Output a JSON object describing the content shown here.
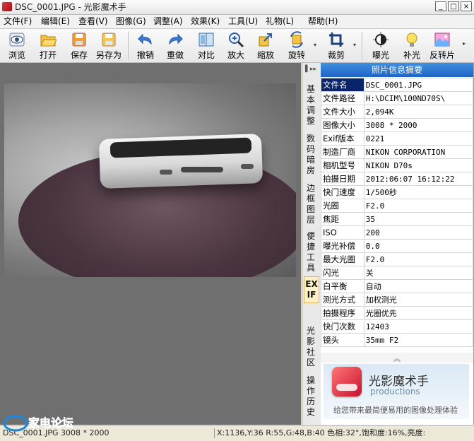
{
  "window": {
    "title": "DSC_0001.JPG - 光影魔术手",
    "min": "_",
    "max": "□",
    "close": "×"
  },
  "menu": [
    "文件(F)",
    "编辑(E)",
    "查看(V)",
    "图像(G)",
    "调整(A)",
    "效果(K)",
    "工具(U)",
    "礼物(L)",
    "帮助(H)"
  ],
  "toolbar": [
    {
      "label": "浏览",
      "icon": "eye-icon"
    },
    {
      "label": "打开",
      "icon": "folder-open-icon"
    },
    {
      "label": "保存",
      "icon": "save-icon"
    },
    {
      "label": "另存为",
      "icon": "save-as-icon"
    },
    {
      "label": "撤销",
      "icon": "undo-icon"
    },
    {
      "label": "重做",
      "icon": "redo-icon"
    },
    {
      "label": "对比",
      "icon": "compare-icon"
    },
    {
      "label": "放大",
      "icon": "zoom-in-icon"
    },
    {
      "label": "缩放",
      "icon": "resize-icon"
    },
    {
      "label": "旋转",
      "icon": "rotate-icon"
    },
    {
      "label": "裁剪",
      "icon": "crop-icon"
    },
    {
      "label": "曝光",
      "icon": "exposure-icon"
    },
    {
      "label": "补光",
      "icon": "fill-light-icon"
    },
    {
      "label": "反转片",
      "icon": "reversal-film-icon"
    }
  ],
  "side_tabs": [
    "基本调整",
    "数码暗房",
    "边框图层",
    "便捷工具",
    "EXIF",
    "光影社区",
    "操作历史"
  ],
  "active_tab": "EXIF",
  "panel": {
    "title": "照片信息摘要",
    "rows": [
      {
        "key": "文件名",
        "value": "DSC_0001.JPG"
      },
      {
        "key": "文件路径",
        "value": "H:\\DCIM\\100ND70S\\"
      },
      {
        "key": "文件大小",
        "value": "2,094K"
      },
      {
        "key": "图像大小",
        "value": "3008 * 2000"
      },
      {
        "key": "Exif版本",
        "value": "0221"
      },
      {
        "key": "制造厂商",
        "value": "NIKON CORPORATION"
      },
      {
        "key": "相机型号",
        "value": "NIKON D70s"
      },
      {
        "key": "拍摄日期",
        "value": "2012:06:07 16:12:22"
      },
      {
        "key": "快门速度",
        "value": "1/500秒"
      },
      {
        "key": "光圈",
        "value": "F2.0"
      },
      {
        "key": "焦距",
        "value": "35"
      },
      {
        "key": "ISO",
        "value": "200"
      },
      {
        "key": "曝光补偿",
        "value": "0.0"
      },
      {
        "key": "最大光圈",
        "value": "F2.0"
      },
      {
        "key": "闪光",
        "value": "关"
      },
      {
        "key": "白平衡",
        "value": "自动"
      },
      {
        "key": "测光方式",
        "value": "加权测光"
      },
      {
        "key": "拍摄程序",
        "value": "光圈优先"
      },
      {
        "key": "快门次数",
        "value": "12403"
      },
      {
        "key": "镜头",
        "value": "35mm F2"
      }
    ]
  },
  "promo": {
    "title": "光影魔术手",
    "subtitle": "productions",
    "slogan": "给您带来最简便易用的图像处理体验"
  },
  "status": {
    "left": "DSC_0001.JPG 3008 * 2000",
    "right": "X:1136,Y:36 R:55,G:48,B:40 色相:32°,饱和度:16%,亮度:"
  },
  "watermark": "家电论坛"
}
